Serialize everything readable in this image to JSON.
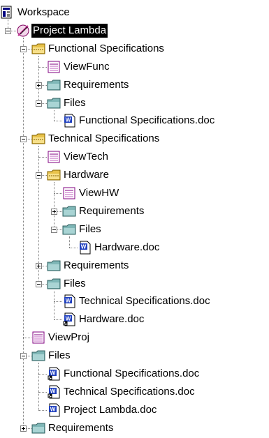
{
  "tree": [
    {
      "label": "Workspace",
      "icon": "workspace-icon",
      "level": 0,
      "expander": "none"
    },
    {
      "label": "Project Lambda",
      "icon": "project-icon",
      "level": 1,
      "expander": "minus",
      "selected": true
    },
    {
      "label": "Functional Specifications",
      "icon": "folder-yellow-icon",
      "level": 2,
      "expander": "minus"
    },
    {
      "label": "ViewFunc",
      "icon": "view-icon",
      "level": 3,
      "expander": "none"
    },
    {
      "label": "Requirements",
      "icon": "folder-teal-icon",
      "level": 3,
      "expander": "plus"
    },
    {
      "label": "Files",
      "icon": "folder-teal-icon",
      "level": 3,
      "expander": "minus"
    },
    {
      "label": "Functional Specifications.doc",
      "icon": "word-doc-icon",
      "level": 4,
      "expander": "none"
    },
    {
      "label": "Technical Specifications",
      "icon": "folder-yellow-icon",
      "level": 2,
      "expander": "minus"
    },
    {
      "label": "ViewTech",
      "icon": "view-icon",
      "level": 3,
      "expander": "none"
    },
    {
      "label": "Hardware",
      "icon": "folder-yellow-icon",
      "level": 3,
      "expander": "minus"
    },
    {
      "label": "ViewHW",
      "icon": "view-icon",
      "level": 4,
      "expander": "none"
    },
    {
      "label": "Requirements",
      "icon": "folder-teal-icon",
      "level": 4,
      "expander": "plus"
    },
    {
      "label": "Files",
      "icon": "folder-teal-icon",
      "level": 4,
      "expander": "minus"
    },
    {
      "label": "Hardware.doc",
      "icon": "word-doc-icon",
      "level": 5,
      "expander": "none"
    },
    {
      "label": "Requirements",
      "icon": "folder-teal-icon",
      "level": 3,
      "expander": "plus"
    },
    {
      "label": "Files",
      "icon": "folder-teal-icon",
      "level": 3,
      "expander": "minus"
    },
    {
      "label": "Technical Specifications.doc",
      "icon": "word-doc-icon",
      "level": 4,
      "expander": "none"
    },
    {
      "label": "Hardware.doc",
      "icon": "word-doc-link-icon",
      "level": 4,
      "expander": "none"
    },
    {
      "label": "ViewProj",
      "icon": "view-icon",
      "level": 2,
      "expander": "none"
    },
    {
      "label": "Files",
      "icon": "folder-teal-icon",
      "level": 2,
      "expander": "minus"
    },
    {
      "label": "Functional Specifications.doc",
      "icon": "word-doc-link-icon",
      "level": 3,
      "expander": "none"
    },
    {
      "label": "Technical Specifications.doc",
      "icon": "word-doc-link-icon",
      "level": 3,
      "expander": "none"
    },
    {
      "label": "Project Lambda.doc",
      "icon": "word-doc-icon",
      "level": 3,
      "expander": "none"
    },
    {
      "label": "Requirements",
      "icon": "folder-teal-icon",
      "level": 2,
      "expander": "plus"
    }
  ],
  "colors": {
    "selection_bg": "#000000",
    "selection_text": "#ffffff",
    "folder_yellow": "#e8c24a",
    "folder_teal": "#7fb7b7",
    "word_blue": "#1f3fbf"
  }
}
